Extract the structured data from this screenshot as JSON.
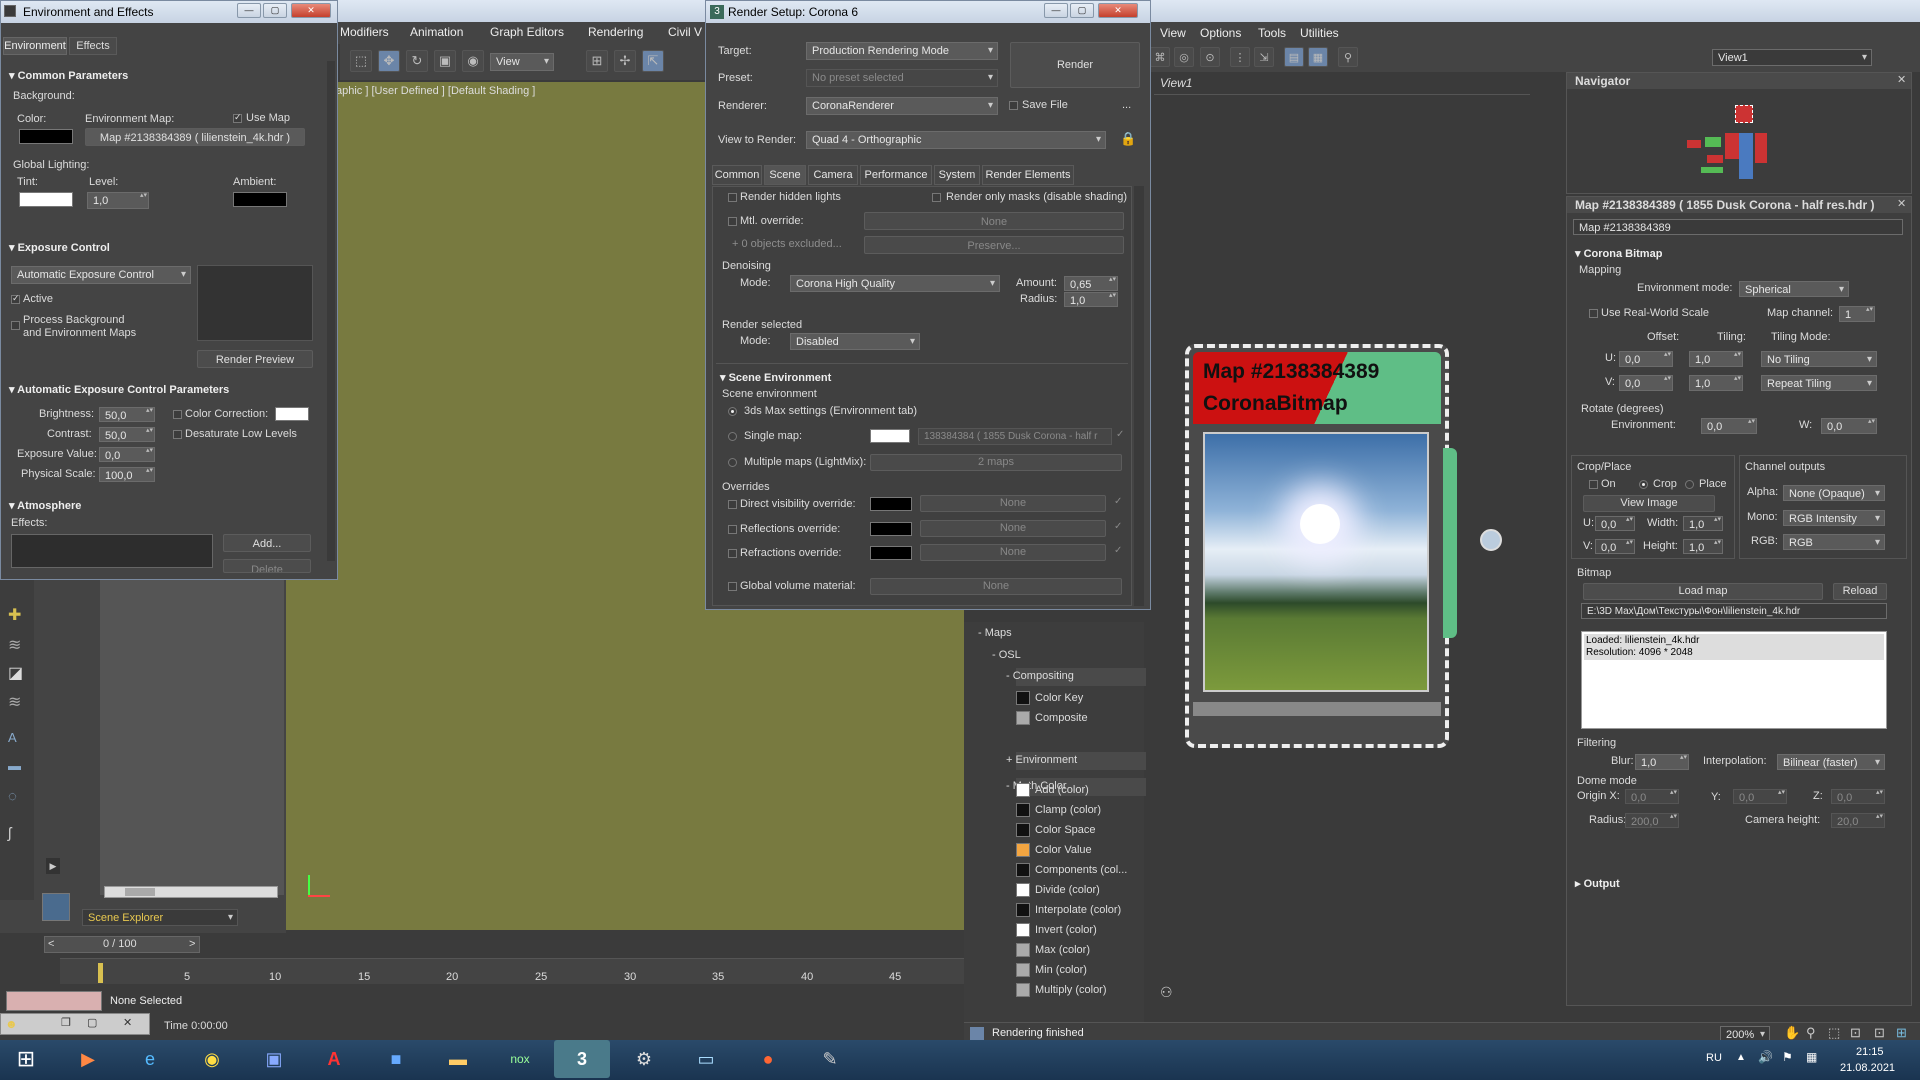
{
  "menubar": [
    "Modifiers",
    "Animation",
    "Graph Editors",
    "Rendering",
    "Civil V"
  ],
  "viewport": {
    "label": "aphic ] [User Defined ] [Default Shading ]"
  },
  "env": {
    "title": "Environment and Effects",
    "tabs": [
      "Environment",
      "Effects"
    ],
    "common_params": "Common Parameters",
    "background": "Background:",
    "color": "Color:",
    "env_map": "Environment Map:",
    "use_map": "Use Map",
    "map_btn": "Map #2138384389 ( lilienstein_4k.hdr )",
    "global_lighting": "Global Lighting:",
    "tint": "Tint:",
    "level": "Level:",
    "level_val": "1,0",
    "ambient": "Ambient:",
    "exposure_control": "Exposure Control",
    "exposure_type": "Automatic Exposure Control",
    "active": "Active",
    "process_bg": "Process Background",
    "process_bg2": "and Environment Maps",
    "render_preview": "Render Preview",
    "auto_params": "Automatic Exposure Control Parameters",
    "brightness": "Brightness:",
    "brightness_val": "50,0",
    "contrast": "Contrast:",
    "contrast_val": "50,0",
    "exposure_value": "Exposure Value:",
    "exposure_value_val": "0,0",
    "physical_scale": "Physical Scale:",
    "physical_scale_val": "100,0",
    "color_correction": "Color Correction:",
    "desaturate": "Desaturate Low Levels",
    "atmosphere": "Atmosphere",
    "effects": "Effects:",
    "add": "Add...",
    "delete": "Delete"
  },
  "render": {
    "title": "Render Setup: Corona 6",
    "target_lbl": "Target:",
    "target": "Production Rendering Mode",
    "preset_lbl": "Preset:",
    "preset": "No preset selected",
    "renderer_lbl": "Renderer:",
    "renderer": "CoronaRenderer",
    "save_file": "Save File",
    "view_lbl": "View to Render:",
    "view": "Quad 4 - Orthographic",
    "render_btn": "Render",
    "more": "...",
    "tabs": [
      "Common",
      "Scene",
      "Camera",
      "Performance",
      "System",
      "Render Elements"
    ],
    "render_hidden": "Render hidden lights",
    "render_masks": "Render only masks (disable shading)",
    "mtl_override": "Mtl. override:",
    "none": "None",
    "objects_excluded": "0 objects excluded...",
    "preserve": "Preserve...",
    "denoising": "Denoising",
    "mode": "Mode:",
    "denoise_mode": "Corona High Quality",
    "amount": "Amount:",
    "amount_val": "0,65",
    "radius": "Radius:",
    "radius_val": "1,0",
    "render_selected": "Render selected",
    "sel_mode": "Disabled",
    "scene_env": "Scene Environment",
    "scene_env_sub": "Scene environment",
    "opt_max": "3ds Max settings (Environment tab)",
    "opt_single": "Single map:",
    "single_map": "138384384 ( 1855 Dusk Corona - half r",
    "opt_multi": "Multiple maps (LightMix):",
    "two_maps": "2 maps",
    "overrides": "Overrides",
    "direct_vis": "Direct visibility override:",
    "reflections": "Reflections override:",
    "refractions": "Refractions override:",
    "global_volume": "Global volume material:"
  },
  "slate": {
    "menu": [
      "View",
      "Options",
      "Tools",
      "Utilities"
    ],
    "view_dd": "View1",
    "view_tab": "View1",
    "node_title1": "Map #2138384389",
    "node_title2": "CoronaBitmap",
    "status": "Rendering finished",
    "zoom": "200%",
    "maps": "Maps",
    "osl": "OSL",
    "compositing": "Compositing",
    "environment": "Environment",
    "math_color": "Math Color",
    "items_comp": [
      {
        "name": "Color Key",
        "color": "#111111"
      },
      {
        "name": "Composite",
        "color": "#aaaaaa"
      }
    ],
    "items_math": [
      {
        "name": "Add (color)",
        "color": "#ffffff"
      },
      {
        "name": "Clamp (color)",
        "color": "#111111"
      },
      {
        "name": "Color Space",
        "color": "#111111"
      },
      {
        "name": "Color Value",
        "color": "#f3a541"
      },
      {
        "name": "Components (col...",
        "color": "#111111"
      },
      {
        "name": "Divide (color)",
        "color": "#ffffff"
      },
      {
        "name": "Interpolate (color)",
        "color": "#111111"
      },
      {
        "name": "Invert (color)",
        "color": "#ffffff"
      },
      {
        "name": "Max (color)",
        "color": "#aaaaaa"
      },
      {
        "name": "Min (color)",
        "color": "#aaaaaa"
      },
      {
        "name": "Multiply (color)",
        "color": "#aaaaaa"
      }
    ]
  },
  "navigator": {
    "title": "Navigator"
  },
  "params": {
    "title": "Map #2138384389 ( 1855 Dusk Corona - half res.hdr )",
    "name": "Map #2138384389",
    "corona_bitmap": "Corona Bitmap",
    "mapping": "Mapping",
    "env_mode_lbl": "Environment mode:",
    "env_mode": "Spherical",
    "real_world": "Use Real-World Scale",
    "map_channel_lbl": "Map channel:",
    "map_channel": "1",
    "offset": "Offset:",
    "tiling": "Tiling:",
    "tiling_mode": "Tiling Mode:",
    "u": "U:",
    "v": "V:",
    "u_off": "0,0",
    "u_til": "1,0",
    "u_mode": "No Tiling",
    "v_off": "0,0",
    "v_til": "1,0",
    "v_mode": "Repeat Tiling",
    "rotate": "Rotate (degrees)",
    "environment": "Environment:",
    "env_rot": "0,0",
    "w": "W:",
    "w_val": "0,0",
    "crop_place": "Crop/Place",
    "on": "On",
    "crop": "Crop",
    "place": "Place",
    "view_image": "View Image",
    "cu": "0,0",
    "width_lbl": "Width:",
    "width": "1,0",
    "cv": "0,0",
    "height_lbl": "Height:",
    "height": "1,0",
    "channel_outputs": "Channel outputs",
    "alpha_lbl": "Alpha:",
    "alpha": "None (Opaque)",
    "mono_lbl": "Mono:",
    "mono": "RGB Intensity",
    "rgb_lbl": "RGB:",
    "rgb": "RGB",
    "bitmap": "Bitmap",
    "load_map": "Load map",
    "reload": "Reload",
    "path": "E:\\3D Max\\Дом\\Текстуры\\Фон\\lilienstein_4k.hdr",
    "loaded": "Loaded: lilienstein_4k.hdr",
    "resolution": "Resolution: 4096 * 2048",
    "filtering": "Filtering",
    "blur_lbl": "Blur:",
    "blur": "1,0",
    "interp_lbl": "Interpolation:",
    "interp": "Bilinear (faster)",
    "dome": "Dome mode",
    "origin_x": "Origin X:",
    "ox": "0,0",
    "y": "Y:",
    "oy": "0,0",
    "z": "Z:",
    "oz": "0,0",
    "radius_lbl": "Radius:",
    "radius": "200,0",
    "cam_h_lbl": "Camera height:",
    "cam_h": "20,0",
    "output": "Output"
  },
  "left": {
    "scene_explorer": "Scene Explorer",
    "frame": "0 / 100",
    "none_selected": "None Selected",
    "time": "Time  0:00:00",
    "ticks": [
      "5",
      "10",
      "15",
      "20",
      "25",
      "30",
      "35",
      "40",
      "45"
    ]
  },
  "taskbar": {
    "lang": "RU",
    "time": "21:15",
    "date": "21.08.2021"
  }
}
